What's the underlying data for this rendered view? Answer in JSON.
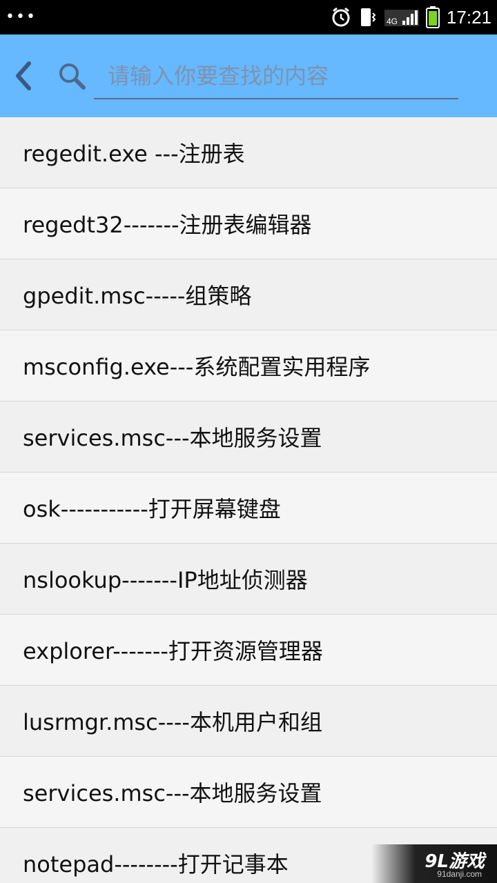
{
  "status_bar": {
    "dots": "•••",
    "network": "4G",
    "time": "17:21"
  },
  "toolbar": {
    "back_icon": "chevron-left-icon",
    "search_icon": "magnifier-icon",
    "search_placeholder": "请输入你要查找的内容",
    "search_value": ""
  },
  "items": [
    "regedit.exe ---注册表",
    "regedt32-------注册表编辑器",
    "gpedit.msc-----组策略",
    "msconfig.exe---系统配置实用程序",
    "services.msc---本地服务设置",
    "osk-----------打开屏幕键盘",
    "nslookup-------IP地址侦测器",
    "explorer-------打开资源管理器",
    "lusrmgr.msc----本机用户和组",
    "services.msc---本地服务设置",
    "notepad--------打开记事本"
  ],
  "watermark": {
    "logo": "9L游戏",
    "url": "91danji.com"
  },
  "colors": {
    "toolbar": "#66b8ff",
    "status_bar": "#000000",
    "list_bg": "#f0f0f0",
    "divider": "#d6d6d6"
  }
}
